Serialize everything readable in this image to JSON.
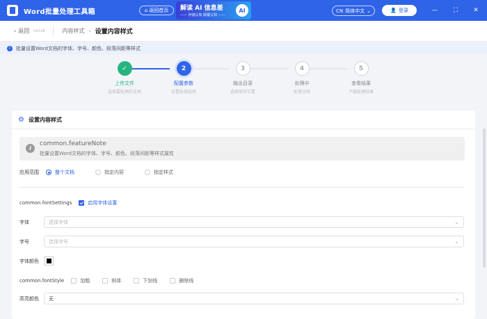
{
  "titlebar": {
    "title": "Word批量处理工具箱",
    "home_label": "返回首页",
    "banner_title": "解读 AI 信息差",
    "banner_sub": "—— 存储认知 颠覆认知 ——",
    "banner_badge": "AI",
    "lang_code": "CN",
    "lang_label": "简体中文",
    "login_label": "登录"
  },
  "header": {
    "back_label": "返回",
    "back_hint": "Ctrl+E",
    "crumb_parent": "内容样式",
    "crumb_current": "设置内容样式"
  },
  "info": {
    "text": "批量设置Word文档的字体、字号、颜色、段落间距等样式"
  },
  "steps": [
    {
      "num": "✓",
      "title": "上传文件",
      "desc": "选择要处理的文档",
      "state": "done"
    },
    {
      "num": "2",
      "title": "配置参数",
      "desc": "设置处理选项",
      "state": "active"
    },
    {
      "num": "3",
      "title": "输出目录",
      "desc": "选择保存位置",
      "state": "todo"
    },
    {
      "num": "4",
      "title": "处理中",
      "desc": "处理文档",
      "state": "todo"
    },
    {
      "num": "5",
      "title": "查看结果",
      "desc": "下载处理结果",
      "state": "todo"
    }
  ],
  "colors": {
    "primary": "#2f63e8",
    "done": "#26b57f"
  },
  "card": {
    "title": "设置内容样式",
    "note_title": "common.featureNote",
    "note_text": "批量设置Word文档的字体、字号、颜色、段落间距等样式属性",
    "scope_label": "应用范围",
    "scope_options": [
      "整个文档",
      "指定内容",
      "指定样式"
    ],
    "font_settings_label": "common.fontSettings",
    "enable_font_label": "启用字体设置",
    "font_label": "字体",
    "font_placeholder": "选择字体",
    "size_label": "字号",
    "size_placeholder": "选择字号",
    "color_label": "字体颜色",
    "font_color": "#000000",
    "style_label": "common.fontStyle",
    "style_options": [
      "加粗",
      "斜体",
      "下划线",
      "删除线"
    ],
    "highlight_label": "高亮颜色",
    "highlight_value": "无"
  }
}
